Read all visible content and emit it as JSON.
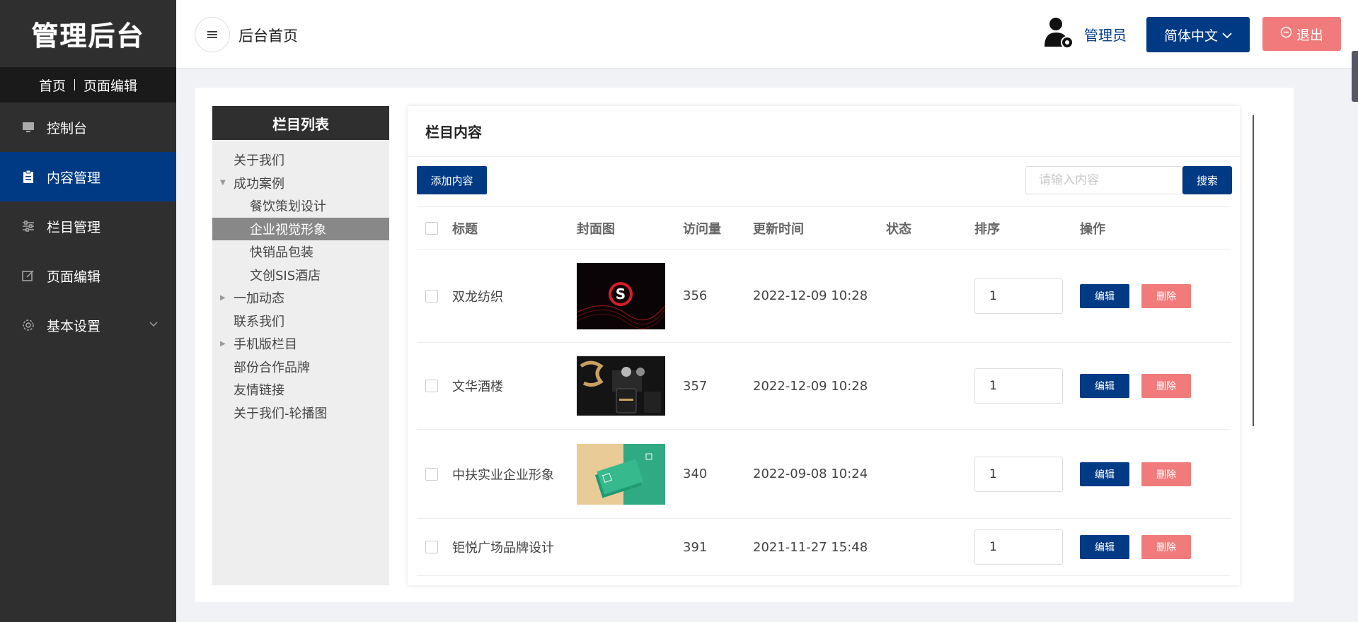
{
  "sidebar": {
    "logo": "管理后台",
    "crumb": {
      "home": "首页",
      "current": "页面编辑"
    },
    "items": [
      {
        "label": "控制台",
        "icon": "monitor-icon"
      },
      {
        "label": "内容管理",
        "icon": "clipboard-icon",
        "active": true
      },
      {
        "label": "栏目管理",
        "icon": "sliders-icon"
      },
      {
        "label": "页面编辑",
        "icon": "edit-icon"
      },
      {
        "label": "基本设置",
        "icon": "gear-icon"
      }
    ]
  },
  "header": {
    "title": "后台首页",
    "admin": "管理员",
    "language": "简体中文",
    "logout": "退出"
  },
  "column_list": {
    "title": "栏目列表",
    "items": [
      {
        "label": "关于我们",
        "level": 1
      },
      {
        "label": "成功案例",
        "level": 1,
        "expanded": true
      },
      {
        "label": "餐饮策划设计",
        "level": 2
      },
      {
        "label": "企业视觉形象",
        "level": 2,
        "selected": true
      },
      {
        "label": "快销品包装",
        "level": 2
      },
      {
        "label": "文创SIS酒店",
        "level": 2
      },
      {
        "label": "一加动态",
        "level": 1,
        "collapsed": true
      },
      {
        "label": "联系我们",
        "level": 1
      },
      {
        "label": "手机版栏目",
        "level": 1,
        "collapsed": true
      },
      {
        "label": "部份合作品牌",
        "level": 1
      },
      {
        "label": "友情链接",
        "level": 1
      },
      {
        "label": "关于我们-轮播图",
        "level": 1
      }
    ]
  },
  "content": {
    "title": "栏目内容",
    "add_label": "添加内容",
    "search_placeholder": "请输入内容",
    "search_label": "搜索",
    "columns": [
      "标题",
      "封面图",
      "访问量",
      "更新时间",
      "状态",
      "排序",
      "操作"
    ],
    "edit_label": "编辑",
    "delete_label": "删除",
    "rows": [
      {
        "title": "双龙纺织",
        "views": "356",
        "time": "2022-12-09 10:28",
        "sort": "1",
        "cover": "red-logo"
      },
      {
        "title": "文华酒楼",
        "views": "357",
        "time": "2022-12-09 10:28",
        "sort": "1",
        "cover": "dark-product"
      },
      {
        "title": "中扶实业企业形象",
        "views": "340",
        "time": "2022-09-08 10:24",
        "sort": "1",
        "cover": "green-cards"
      },
      {
        "title": "钜悦广场品牌设计",
        "views": "391",
        "time": "2021-11-27 15:48",
        "sort": "1",
        "cover": ""
      }
    ]
  }
}
